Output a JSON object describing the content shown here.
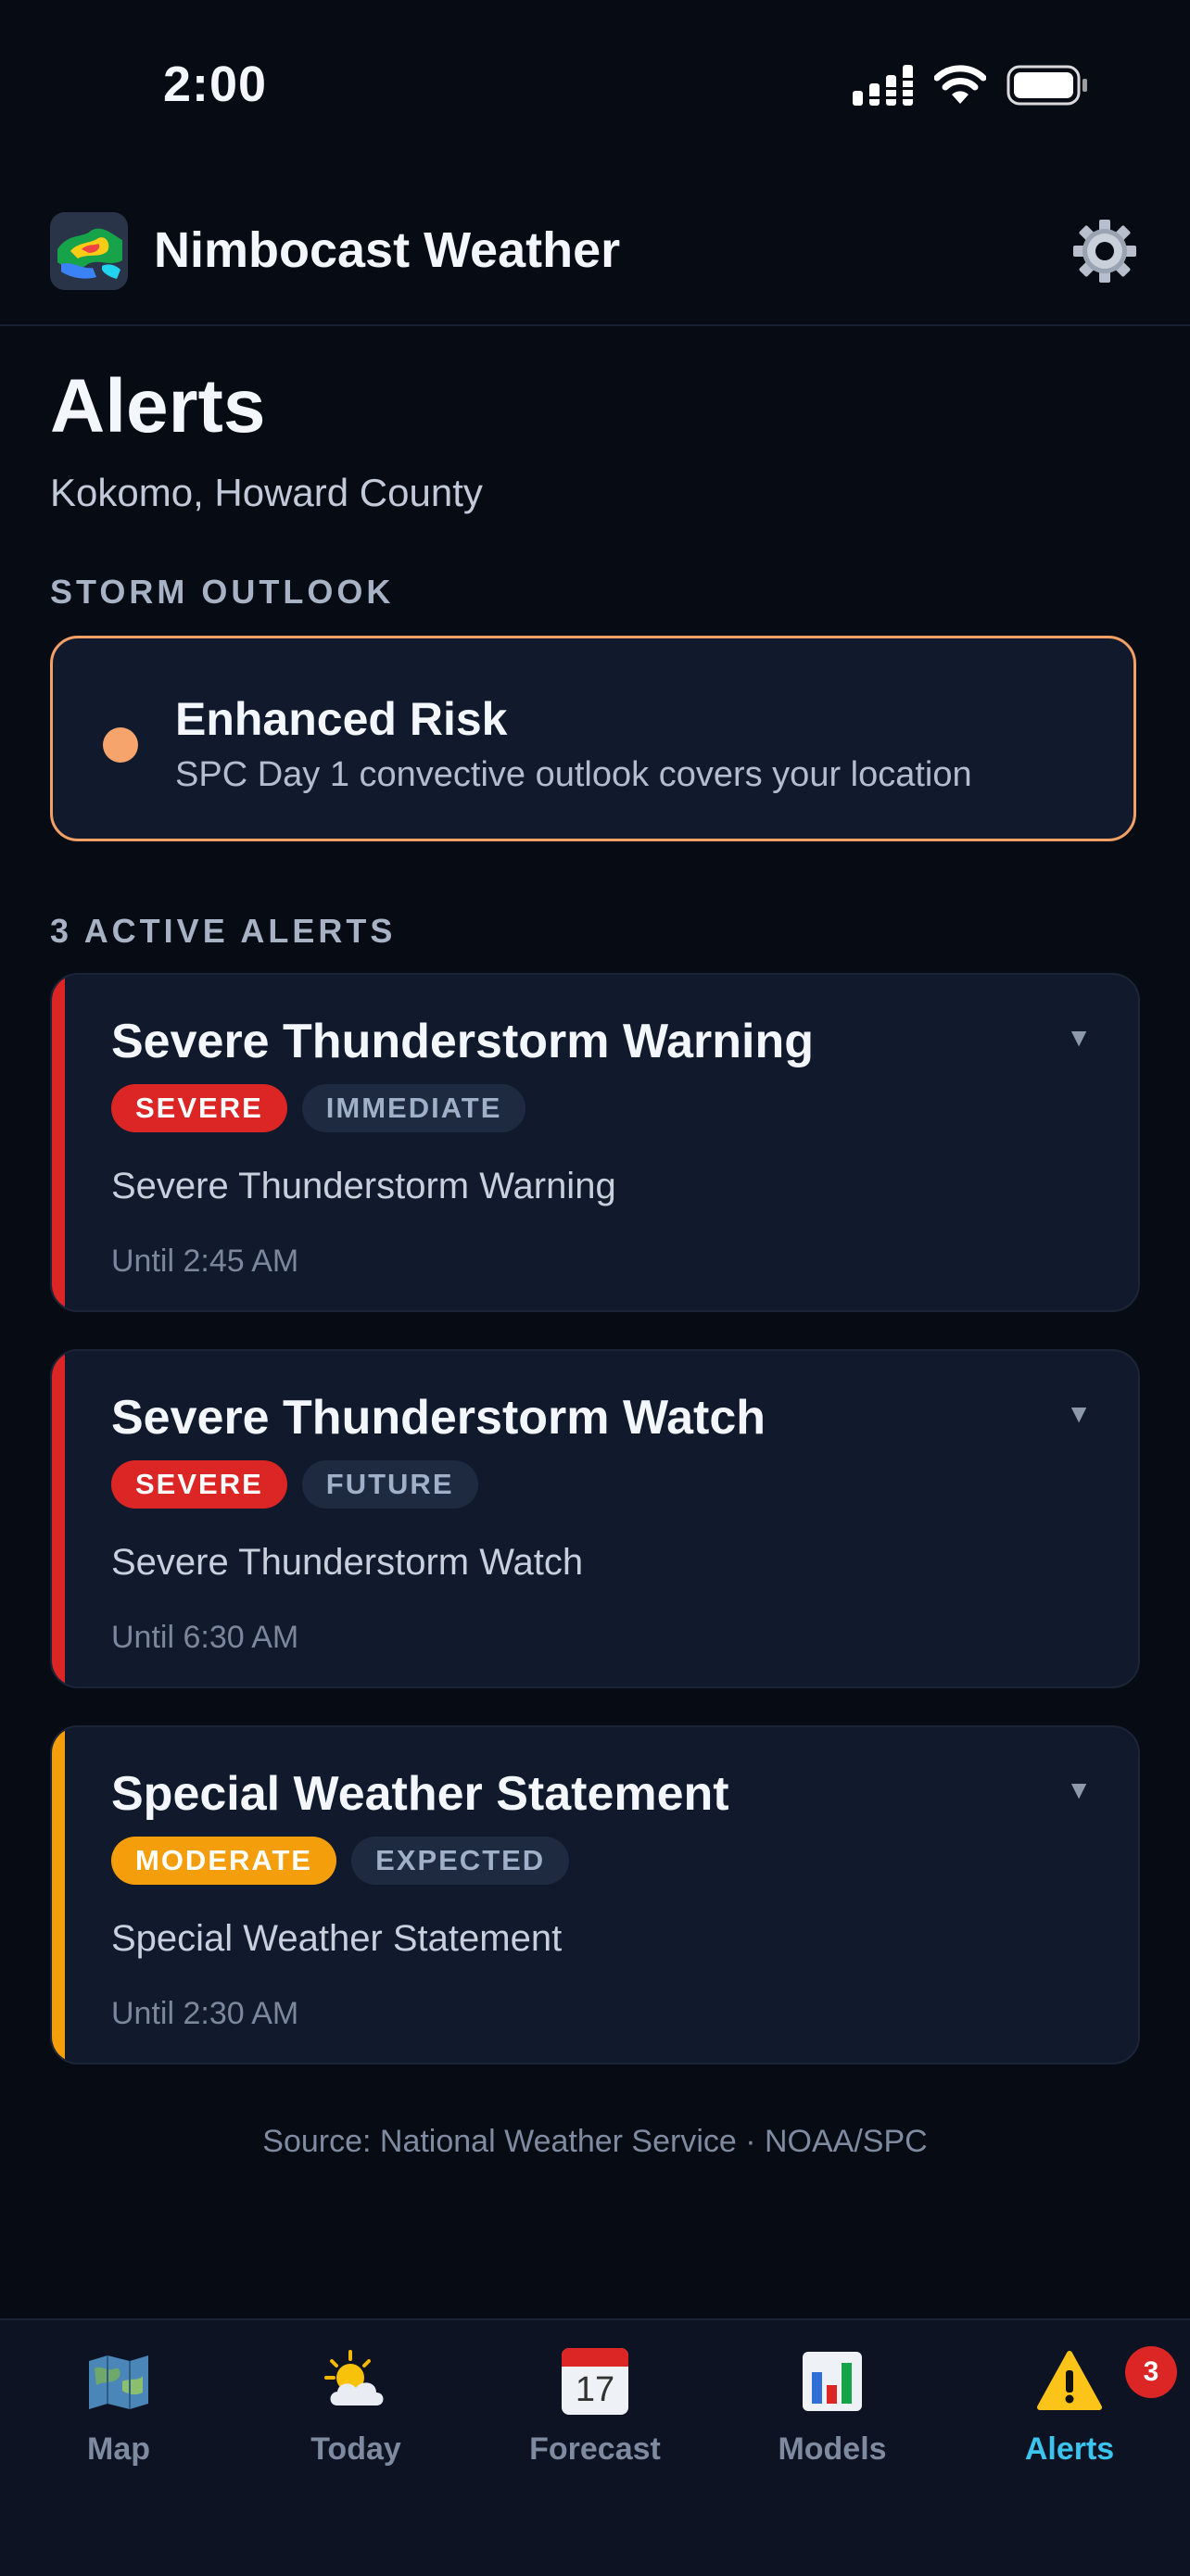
{
  "status_bar": {
    "time": "2:00",
    "icons": [
      "cellular-signal-icon",
      "wifi-icon",
      "battery-icon"
    ]
  },
  "header": {
    "app_title": "Nimbocast Weather",
    "logo_icon": "radar-logo-icon",
    "settings_icon": "gear-icon"
  },
  "page": {
    "title": "Alerts",
    "location": "Kokomo, Howard County"
  },
  "outlook": {
    "section_label": "STORM OUTLOOK",
    "risk_title": "Enhanced Risk",
    "description": "SPC Day 1 convective outlook covers your location",
    "color": "#f6a46c"
  },
  "alerts_section": {
    "label": "3 ACTIVE ALERTS",
    "items": [
      {
        "title": "Severe Thunderstorm Warning",
        "severity": "SEVERE",
        "urgency": "IMMEDIATE",
        "event": "Severe Thunderstorm Warning",
        "until": "Until 2:45 AM",
        "accent_color": "#dc2626",
        "toggle": "▼"
      },
      {
        "title": "Severe Thunderstorm Watch",
        "severity": "SEVERE",
        "urgency": "FUTURE",
        "event": "Severe Thunderstorm Watch",
        "until": "Until 6:30 AM",
        "accent_color": "#dc2626",
        "toggle": "▼"
      },
      {
        "title": "Special Weather Statement",
        "severity": "MODERATE",
        "urgency": "EXPECTED",
        "event": "Special Weather Statement",
        "until": "Until 2:30 AM",
        "accent_color": "#f59e0b",
        "toggle": "▼"
      }
    ]
  },
  "footer": {
    "source": "Source: National Weather Service · NOAA/SPC"
  },
  "tab_bar": {
    "active": "Alerts",
    "accent_color": "#3bc4ee",
    "items": [
      {
        "label": "Map",
        "icon": "map-icon"
      },
      {
        "label": "Today",
        "icon": "sun-behind-cloud-icon"
      },
      {
        "label": "Forecast",
        "icon": "calendar-icon",
        "calendar_day": "17"
      },
      {
        "label": "Models",
        "icon": "bar-chart-icon"
      },
      {
        "label": "Alerts",
        "icon": "warning-icon",
        "badge": "3"
      }
    ]
  }
}
